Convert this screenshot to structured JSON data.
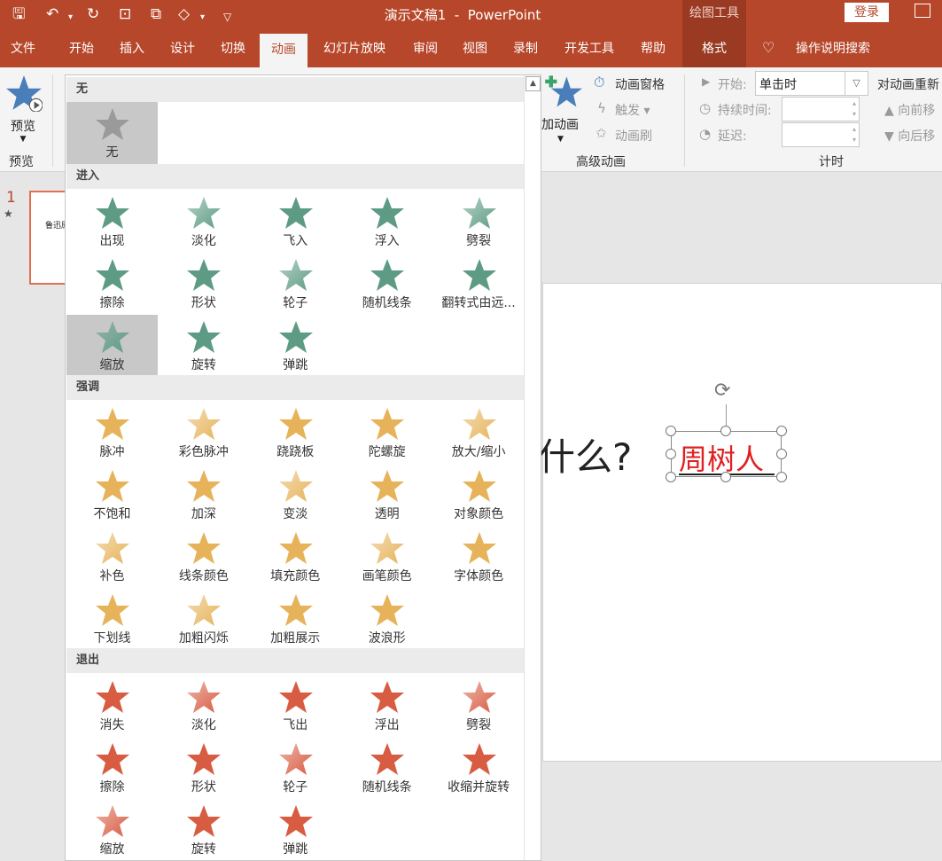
{
  "title": "演示文稿1  -  PowerPoint",
  "context_tab_group": "绘图工具",
  "login": "登录",
  "tabs": [
    "文件",
    "开始",
    "插入",
    "设计",
    "切换",
    "动画",
    "幻灯片放映",
    "审阅",
    "视图",
    "录制",
    "开发工具",
    "帮助",
    "格式"
  ],
  "search_label": "操作说明搜索",
  "ribbon": {
    "preview_label": "预览",
    "preview_group": "预览",
    "add_animation": "添加动画",
    "animation_pane": "动画窗格",
    "trigger": "触发",
    "painter": "动画刷",
    "advanced_group": "高级动画",
    "start_label": "开始:",
    "start_value": "单击时",
    "duration_label": "持续时间:",
    "delay_label": "延迟:",
    "timing_group": "计时",
    "reorder": "对动画重新",
    "move_earlier": "向前移",
    "move_later": "向后移"
  },
  "panel": {
    "none": {
      "header": "无",
      "label": "无"
    },
    "entrance": {
      "header": "进入",
      "items": [
        "出现",
        "淡化",
        "飞入",
        "浮入",
        "劈裂",
        "擦除",
        "形状",
        "轮子",
        "随机线条",
        "翻转式由远...",
        "缩放",
        "旋转",
        "弹跳"
      ],
      "selected": "缩放"
    },
    "emphasis": {
      "header": "强调",
      "items": [
        "脉冲",
        "彩色脉冲",
        "跷跷板",
        "陀螺旋",
        "放大/缩小",
        "不饱和",
        "加深",
        "变淡",
        "透明",
        "对象颜色",
        "补色",
        "线条颜色",
        "填充颜色",
        "画笔颜色",
        "字体颜色",
        "下划线",
        "加粗闪烁",
        "加粗展示",
        "波浪形"
      ]
    },
    "exit": {
      "header": "退出",
      "items": [
        "消失",
        "淡化",
        "飞出",
        "浮出",
        "劈裂",
        "擦除",
        "形状",
        "轮子",
        "随机线条",
        "收缩并旋转",
        "缩放",
        "旋转",
        "弹跳"
      ]
    }
  },
  "slide": {
    "number": "1",
    "thumb_text": "鲁迅原",
    "question_text": "什么?",
    "selected_text": "周树人"
  },
  "colors": {
    "accent": "#b7472a",
    "entrance": "#5d9b84",
    "emphasis": "#e6b35a",
    "exit": "#d85c42",
    "none": "#9a9a9a",
    "preview": "#4a7ebb",
    "selected_text": "#e02020"
  }
}
